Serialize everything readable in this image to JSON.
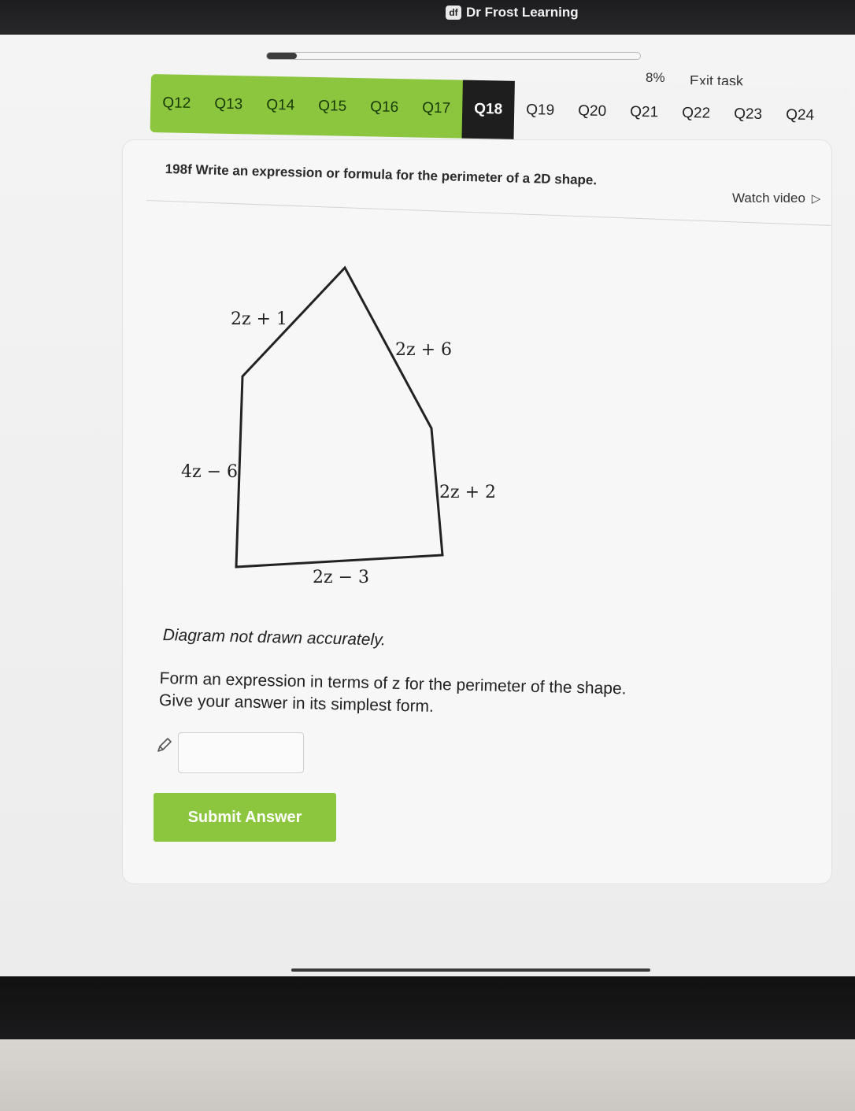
{
  "header": {
    "brand_logo": "df",
    "brand_name": "Dr Frost Learning"
  },
  "progress": {
    "percent": 8,
    "label": "8%"
  },
  "exit_task_label": "Exit task",
  "question_tabs": [
    {
      "label": "Q12",
      "state": "past"
    },
    {
      "label": "Q13",
      "state": "past"
    },
    {
      "label": "Q14",
      "state": "past"
    },
    {
      "label": "Q15",
      "state": "past"
    },
    {
      "label": "Q16",
      "state": "past"
    },
    {
      "label": "Q17",
      "state": "past"
    },
    {
      "label": "Q18",
      "state": "current"
    },
    {
      "label": "Q19",
      "state": "future"
    },
    {
      "label": "Q20",
      "state": "future"
    },
    {
      "label": "Q21",
      "state": "future"
    },
    {
      "label": "Q22",
      "state": "future"
    },
    {
      "label": "Q23",
      "state": "future"
    },
    {
      "label": "Q24",
      "state": "future"
    }
  ],
  "question": {
    "title": "198f Write an expression or formula for the perimeter of a 2D shape.",
    "watch_video_label": "Watch video",
    "diagram_labels": {
      "top_left": "2z + 1",
      "top_right": "2z + 6",
      "left": "4z − 6",
      "right": "2z + 2",
      "bottom": "2z − 3"
    },
    "note": "Diagram not drawn accurately.",
    "instruction_line1": "Form an expression in terms of z for the perimeter of the shape.",
    "instruction_line2": "Give your answer in its simplest form.",
    "answer_value": "",
    "submit_label": "Submit Answer"
  },
  "colors": {
    "accent_green": "#8cc63f",
    "current_tab": "#1e1e1e"
  }
}
